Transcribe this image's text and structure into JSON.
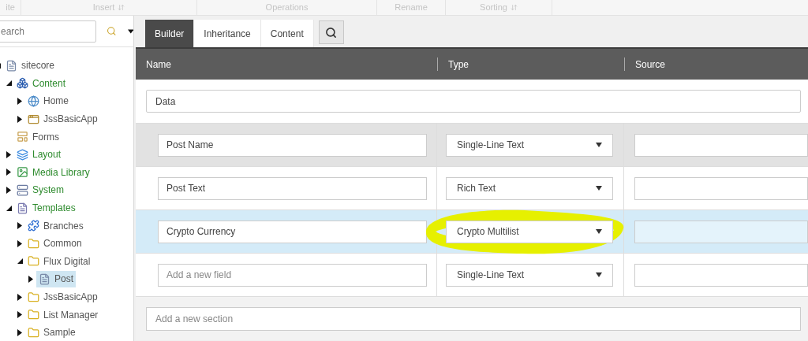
{
  "ribbon": [
    {
      "label": "ite",
      "icon": false
    },
    {
      "label": "Insert",
      "icon": true
    },
    {
      "label": "Operations",
      "icon": false
    },
    {
      "label": "Rename",
      "icon": false
    },
    {
      "label": "Sorting",
      "icon": true
    }
  ],
  "search": {
    "placeholder": "earch"
  },
  "tree": [
    {
      "label": "sitecore",
      "kind": "document",
      "color": "#555555",
      "expanded": true,
      "children": [
        {
          "label": "Content",
          "kind": "cubes",
          "color": "#2e8b2e",
          "expanded": true,
          "children": [
            {
              "label": "Home",
              "kind": "globe",
              "color": "#555555",
              "expanded": false,
              "selected": false
            },
            {
              "label": "JssBasicApp",
              "kind": "app",
              "color": "#555555",
              "expanded": false,
              "selected": false
            }
          ],
          "selected": false
        },
        {
          "label": "Forms",
          "kind": "form",
          "color": "#555555",
          "selected": false
        },
        {
          "label": "Layout",
          "kind": "layout",
          "color": "#2e8b2e",
          "expanded": false,
          "selected": false
        },
        {
          "label": "Media Library",
          "kind": "image",
          "color": "#2e8b2e",
          "expanded": false,
          "selected": false
        },
        {
          "label": "System",
          "kind": "system",
          "color": "#2e8b2e",
          "expanded": false,
          "selected": false
        },
        {
          "label": "Templates",
          "kind": "template",
          "color": "#2e8b2e",
          "expanded": true,
          "selected": false,
          "children": [
            {
              "label": "Branches",
              "kind": "puzzle",
              "color": "#555555",
              "expanded": false,
              "selected": false
            },
            {
              "label": "Common",
              "kind": "folder",
              "color": "#555555",
              "expanded": false,
              "selected": false
            },
            {
              "label": "Flux Digital",
              "kind": "folder",
              "color": "#555555",
              "expanded": true,
              "selected": false,
              "children": [
                {
                  "label": "Post",
                  "kind": "document",
                  "color": "#555555",
                  "expanded": false,
                  "selected": true
                }
              ]
            },
            {
              "label": "JssBasicApp",
              "kind": "folder",
              "color": "#555555",
              "expanded": false,
              "selected": false
            },
            {
              "label": "List Manager",
              "kind": "folder",
              "color": "#555555",
              "expanded": false,
              "selected": false
            },
            {
              "label": "Sample",
              "kind": "folder",
              "color": "#555555",
              "expanded": false,
              "selected": false
            }
          ]
        }
      ],
      "selected": false
    }
  ],
  "tabs": [
    {
      "label": "Builder",
      "selected": true
    },
    {
      "label": "Inheritance",
      "selected": false
    },
    {
      "label": "Content",
      "selected": false
    }
  ],
  "columns": [
    "Name",
    "Type",
    "Source"
  ],
  "section": {
    "value": "Data"
  },
  "fields": [
    {
      "name": "Post Name",
      "type": "Single-Line Text",
      "hovered": true,
      "selected": false,
      "circled": false
    },
    {
      "name": "Post Text",
      "type": "Rich Text",
      "hovered": false,
      "selected": false,
      "circled": false
    },
    {
      "name": "Crypto Currency",
      "type": "Crypto Multilist",
      "hovered": false,
      "selected": true,
      "circled": true
    },
    {
      "placeholder": "Add a new field",
      "type": "Single-Line Text",
      "hovered": false,
      "selected": false,
      "circled": false
    }
  ],
  "new_section": {
    "placeholder": "Add a new section"
  }
}
